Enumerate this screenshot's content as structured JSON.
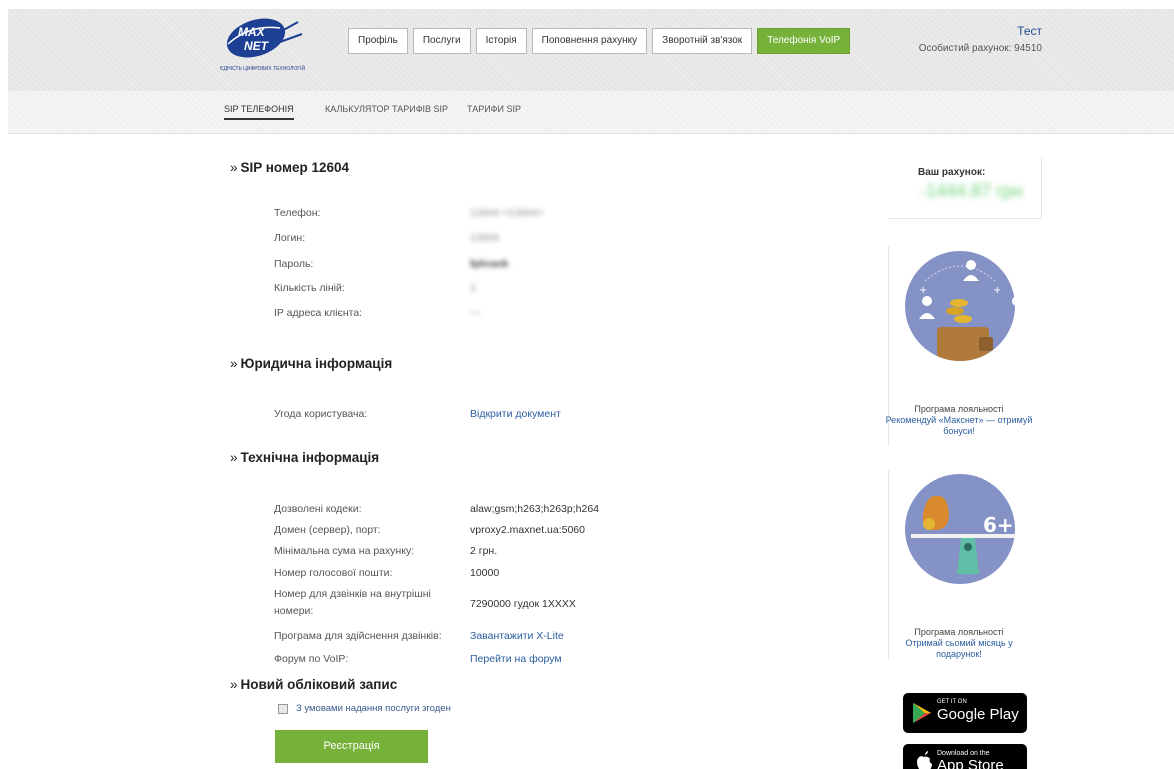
{
  "logo": {
    "text": "MAX NET",
    "tagline": "ЄДНІСТЬ ЦИФРОВИХ ТЕХНОЛОГІЙ"
  },
  "nav": {
    "items": [
      {
        "label": "Профіль"
      },
      {
        "label": "Послуги"
      },
      {
        "label": "Історія"
      },
      {
        "label": "Поповнення рахунку"
      },
      {
        "label": "Зворотній зв'язок"
      },
      {
        "label": "Телефонія VoIP"
      }
    ],
    "active": "Телефонія VoIP"
  },
  "user": {
    "name": "Тест",
    "account": "Особистий рахунок: 94510"
  },
  "subnav": {
    "tabs": [
      {
        "label": "SIP ТЕЛЕФОНІЯ"
      },
      {
        "label": "КАЛЬКУЛЯТОР ТАРИФІВ SIP"
      },
      {
        "label": "ТАРИФИ SIP"
      }
    ]
  },
  "sip": {
    "title": "SIP номер 12604",
    "rows": [
      {
        "label": "Телефон:",
        "value": "12604 <12604>"
      },
      {
        "label": "Логин:",
        "value": "12604"
      },
      {
        "label": "Пароль:",
        "value": "fphrank"
      },
      {
        "label": "Кількість ліній:",
        "value": "2"
      },
      {
        "label": "IP адреса клієнта:",
        "value": "—"
      }
    ]
  },
  "legal": {
    "title": "Юридична інформація",
    "rows": [
      {
        "label": "Угода користувача:",
        "value": "Відкрити документ"
      }
    ]
  },
  "tech": {
    "title": "Технічна інформація",
    "rows": [
      {
        "label": "Дозволені кодеки:",
        "value": "alaw;gsm;h263;h263p;h264"
      },
      {
        "label": "Домен (сервер), порт:",
        "value": "vproxy2.maxnet.ua:5060"
      },
      {
        "label": "Мінімальна сума на рахунку:",
        "value": "2 грн."
      },
      {
        "label": "Номер голосової пошти:",
        "value": "10000"
      },
      {
        "label": "Номер для дзвінків на внутрішні номери:",
        "value": "7290000 гудок 1XXXX"
      },
      {
        "label": "Програма для здійснення дзвінків:",
        "value": "Завантажити X-Lite"
      },
      {
        "label": "Форум по VoIP:",
        "value": "Перейти на форум"
      }
    ]
  },
  "new_account": {
    "title": "Новий обліковий запис",
    "agree_label": "З умовами надання послуги згоден",
    "register_label": "Реєстрація"
  },
  "sidebar": {
    "account_label": "Ваш рахунок:",
    "account_sum": "-1444.87 грн",
    "promo1": {
      "title": "Програма лояльності",
      "text": "Рекомендуй «Макснет» — отримуй бонуси!"
    },
    "promo2": {
      "title": "Програма лояльності",
      "text": "Отримай сьомий місяць у подарунок!",
      "badge": "6+1"
    },
    "google_play": {
      "small": "GET IT ON",
      "big": "Google Play"
    },
    "app_store": {
      "small": "Download on the",
      "big": "App Store"
    }
  },
  "colors": {
    "accent_green": "#76b13a",
    "link_blue": "#2a5d9f",
    "promo_circle": "#8492c6"
  }
}
